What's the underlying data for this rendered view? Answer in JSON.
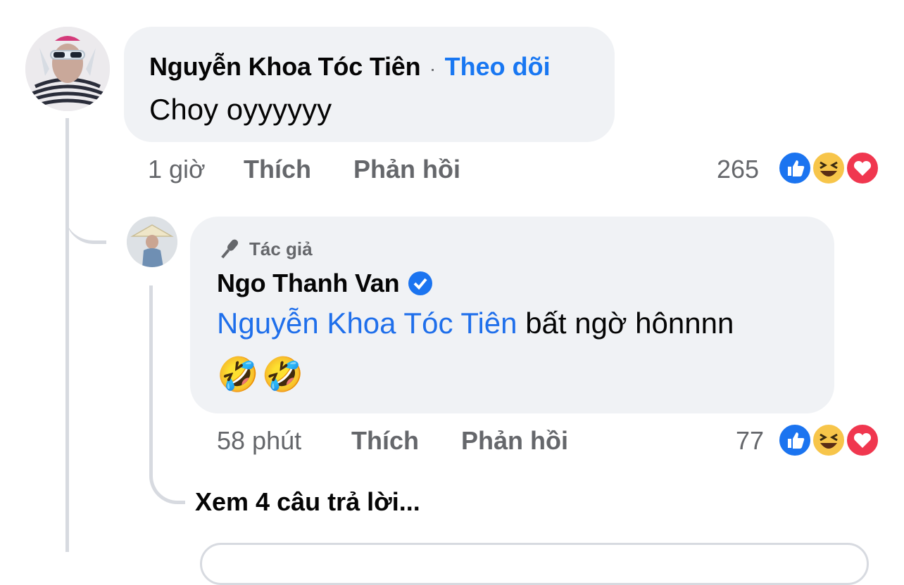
{
  "comment": {
    "author": "Nguyễn Khoa Tóc Tiên",
    "separator": "·",
    "follow_label": "Theo dõi",
    "text": "Choy oyyyyyy",
    "time": "1 giờ",
    "like_label": "Thích",
    "reply_label": "Phản hồi",
    "reaction_count": "265"
  },
  "reply": {
    "badge_label": "Tác giả",
    "author": "Ngo Thanh Van",
    "mention": "Nguyễn Khoa Tóc Tiên",
    "text": "bất ngờ hônnnn",
    "emojis": "🤣🤣",
    "time": "58 phút",
    "like_label": "Thích",
    "reply_label": "Phản hồi",
    "reaction_count": "77"
  },
  "view_more_label": "Xem 4 câu trả lời...",
  "colors": {
    "bubble": "#f0f2f5",
    "link": "#1877f2",
    "muted": "#65676b",
    "like": "#1b74f0",
    "haha": "#f7c54a",
    "love": "#f0374f"
  },
  "icons": [
    "like-reaction-icon",
    "haha-reaction-icon",
    "love-reaction-icon",
    "microphone-icon",
    "verified-badge-icon"
  ]
}
